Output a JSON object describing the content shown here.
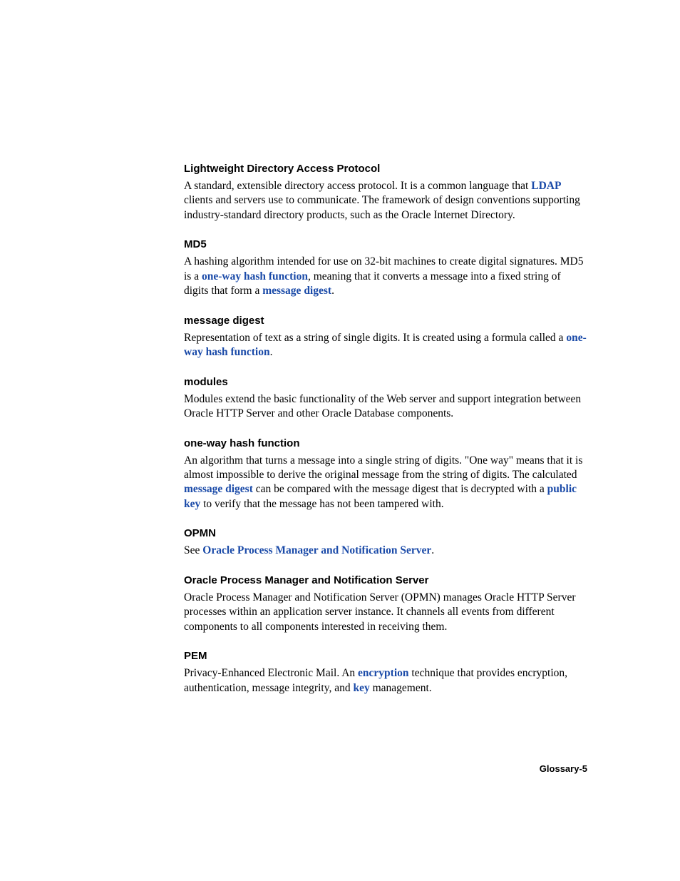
{
  "entries": [
    {
      "term": "Lightweight Directory Access Protocol",
      "body": [
        {
          "t": "text",
          "v": "A standard, extensible directory access protocol. It is a common language that "
        },
        {
          "t": "link",
          "v": "LDAP"
        },
        {
          "t": "text",
          "v": " clients and servers use to communicate. The framework of design conventions supporting industry-standard directory products, such as the Oracle Internet Directory."
        }
      ]
    },
    {
      "term": "MD5",
      "body": [
        {
          "t": "text",
          "v": "A hashing algorithm intended for use on 32-bit machines to create digital signatures. MD5 is a "
        },
        {
          "t": "link",
          "v": "one-way hash function"
        },
        {
          "t": "text",
          "v": ", meaning that it converts a message into a fixed string of digits that form a "
        },
        {
          "t": "link",
          "v": "message digest"
        },
        {
          "t": "text",
          "v": "."
        }
      ]
    },
    {
      "term": "message digest",
      "body": [
        {
          "t": "text",
          "v": "Representation of text as a string of single digits. It is created using a formula called a "
        },
        {
          "t": "link",
          "v": "one-way hash function"
        },
        {
          "t": "text",
          "v": "."
        }
      ]
    },
    {
      "term": "modules",
      "body": [
        {
          "t": "text",
          "v": "Modules extend the basic functionality of the Web server and support integration between Oracle HTTP Server and other Oracle Database components."
        }
      ]
    },
    {
      "term": "one-way hash function",
      "body": [
        {
          "t": "text",
          "v": "An algorithm that turns a message into a single string of digits. \"One way\" means that it is almost impossible to derive the original message from the string of digits. The calculated "
        },
        {
          "t": "link",
          "v": "message digest"
        },
        {
          "t": "text",
          "v": " can be compared with the message digest that is decrypted with a "
        },
        {
          "t": "link",
          "v": "public key"
        },
        {
          "t": "text",
          "v": " to verify that the message has not been tampered with."
        }
      ]
    },
    {
      "term": "OPMN",
      "body": [
        {
          "t": "text",
          "v": "See "
        },
        {
          "t": "link",
          "v": "Oracle Process Manager and Notification Server"
        },
        {
          "t": "text",
          "v": "."
        }
      ]
    },
    {
      "term": "Oracle Process Manager and Notification Server",
      "body": [
        {
          "t": "text",
          "v": "Oracle Process Manager and Notification Server (OPMN) manages Oracle HTTP Server processes within an application server instance. It channels all events from different components to all components interested in receiving them."
        }
      ]
    },
    {
      "term": "PEM",
      "body": [
        {
          "t": "text",
          "v": "Privacy-Enhanced Electronic Mail. An "
        },
        {
          "t": "link",
          "v": "encryption"
        },
        {
          "t": "text",
          "v": " technique that provides encryption, authentication, message integrity, and "
        },
        {
          "t": "link",
          "v": "key"
        },
        {
          "t": "text",
          "v": " management."
        }
      ]
    }
  ],
  "footer": "Glossary-5"
}
